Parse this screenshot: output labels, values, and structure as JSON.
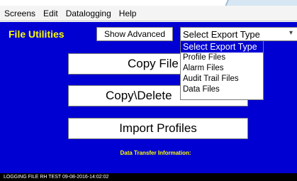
{
  "menubar": {
    "items": [
      "Screens",
      "Edit",
      "Datalogging",
      "Help"
    ]
  },
  "screen": {
    "title": "File Utilities",
    "show_advanced_label": "Show Advanced",
    "export_select": {
      "value": "Select Export Type",
      "options": [
        "Select Export Type",
        "Profile Files",
        "Alarm Files",
        "Audit Trail Files",
        "Data Files"
      ],
      "highlighted_index": 0
    },
    "buttons": {
      "copy_files": "Copy File",
      "copy_delete": "Copy\\Delete",
      "import_profiles": "Import Profiles"
    },
    "data_transfer_label": "Data Transfer Information:"
  },
  "status": {
    "text": "LOGGING FILE RH TEST  09-08-2016-14:02:02"
  },
  "colors": {
    "screen_bg": "#0000d2",
    "title_color": "#ffff00",
    "status_bg": "#000000"
  }
}
